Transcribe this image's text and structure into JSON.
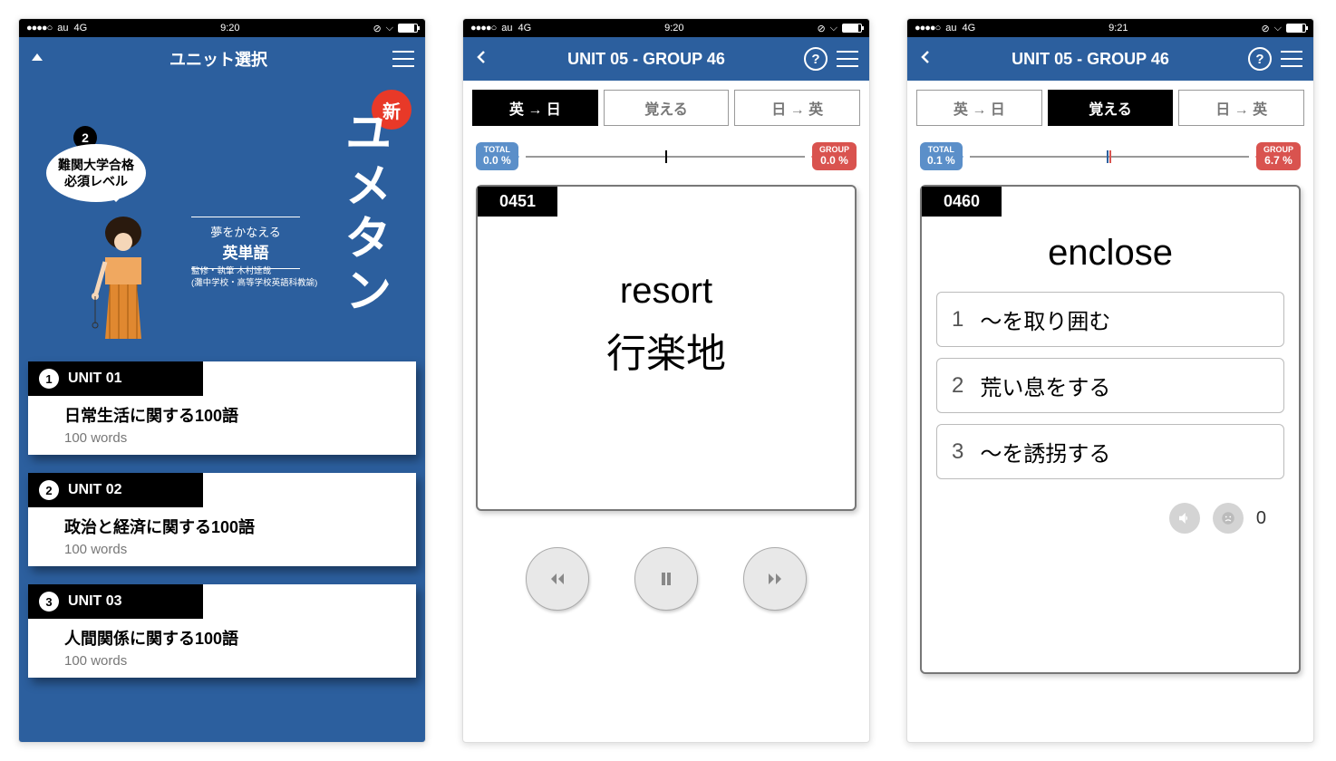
{
  "status": {
    "carrier": "au",
    "net": "4G",
    "time1": "9:20",
    "time2": "9:20",
    "time3": "9:21"
  },
  "s1": {
    "title": "ユニット選択",
    "badge": "2",
    "speech": "難関大学合格必須レベル",
    "strip_a": "夢をかなえる",
    "strip_b": "英単語",
    "strip2a": "監修・執筆 木村達哉",
    "strip2b": "(灘中学校・高等学校英語科教諭)",
    "vtitle": "ユメタン",
    "new": "新",
    "units": [
      {
        "num": "1",
        "name": "UNIT 01",
        "desc": "日常生活に関する100語",
        "words": "100 words"
      },
      {
        "num": "2",
        "name": "UNIT 02",
        "desc": "政治と経済に関する100語",
        "words": "100 words"
      },
      {
        "num": "3",
        "name": "UNIT 03",
        "desc": "人間関係に関する100語",
        "words": "100 words"
      }
    ]
  },
  "s2": {
    "title": "UNIT 05 - GROUP 46",
    "tabs": [
      "英 → 日",
      "覚える",
      "日 → 英"
    ],
    "total_lbl": "TOTAL",
    "total_val": "0.0 %",
    "group_lbl": "GROUP",
    "group_val": "0.0 %",
    "card_num": "0451",
    "word_en": "resort",
    "word_jp": "行楽地"
  },
  "s3": {
    "title": "UNIT 05 - GROUP 46",
    "tabs": [
      "英 → 日",
      "覚える",
      "日 → 英"
    ],
    "total_lbl": "TOTAL",
    "total_val": "0.1 %",
    "group_lbl": "GROUP",
    "group_val": "6.7 %",
    "card_num": "0460",
    "word_en": "enclose",
    "choices": [
      {
        "n": "1",
        "t": "〜を取り囲む"
      },
      {
        "n": "2",
        "t": "荒い息をする"
      },
      {
        "n": "3",
        "t": "〜を誘拐する"
      }
    ],
    "count": "0"
  }
}
